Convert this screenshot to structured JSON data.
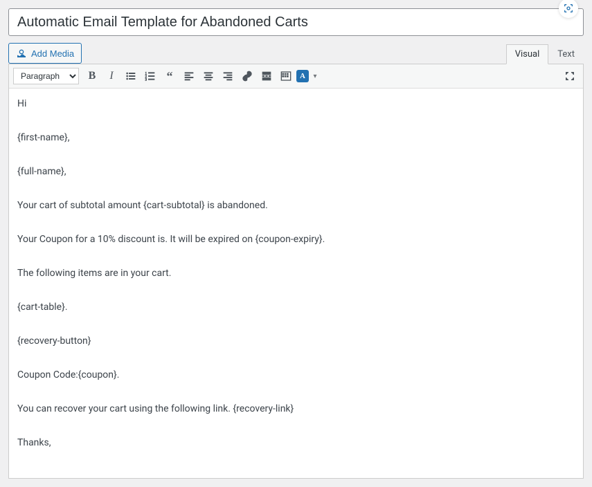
{
  "title": {
    "value": "Automatic Email Template for Abandoned Carts"
  },
  "media": {
    "add_label": "Add Media"
  },
  "tabs": {
    "visual": "Visual",
    "text": "Text"
  },
  "toolbar": {
    "format": "Paragraph",
    "badge": "A"
  },
  "body": {
    "p1": "Hi",
    "p2": "{first-name},",
    "p3": "{full-name},",
    "p4": "Your cart of subtotal amount {cart-subtotal} is abandoned.",
    "p5": "Your Coupon for a 10% discount is. It will be expired on {coupon-expiry}.",
    "p6": "The following items are in your cart.",
    "p7": "{cart-table}.",
    "p8": "{recovery-button}",
    "p9": "Coupon Code:{coupon}.",
    "p10": "You can recover your cart using the following link. {recovery-link}",
    "p11": "Thanks,"
  }
}
